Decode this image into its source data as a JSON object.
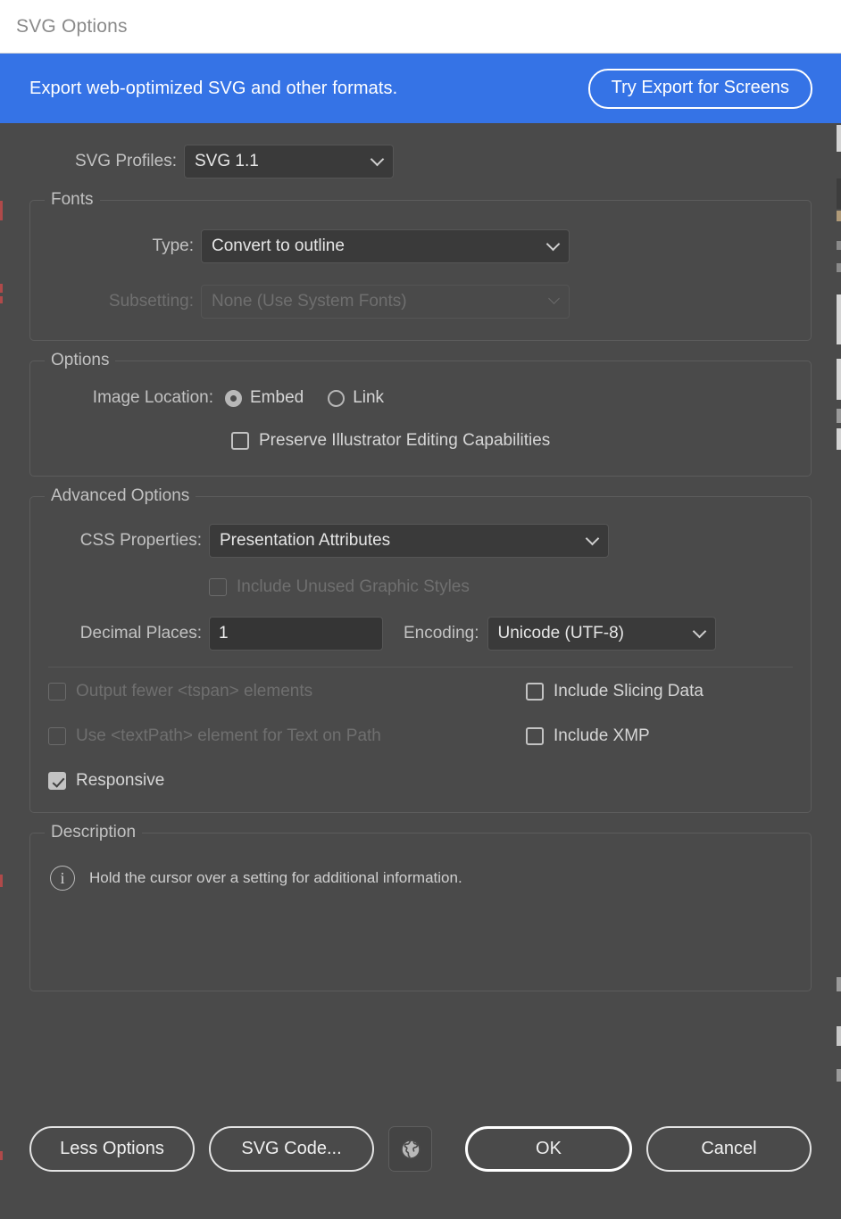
{
  "window": {
    "title": "SVG Options"
  },
  "promo": {
    "message": "Export web-optimized SVG and other formats.",
    "button_label": "Try Export for Screens",
    "background_color": "#3573e6"
  },
  "profiles": {
    "label": "SVG Profiles:",
    "value": "SVG 1.1"
  },
  "fonts": {
    "legend": "Fonts",
    "type": {
      "label": "Type:",
      "value": "Convert to outline"
    },
    "subsetting": {
      "label": "Subsetting:",
      "value": "None (Use System Fonts)",
      "enabled": false
    }
  },
  "options": {
    "legend": "Options",
    "image_location": {
      "label": "Image Location:",
      "choices": [
        {
          "label": "Embed",
          "selected": true
        },
        {
          "label": "Link",
          "selected": false
        }
      ]
    },
    "preserve": {
      "label": "Preserve Illustrator Editing Capabilities",
      "checked": false,
      "enabled": true
    }
  },
  "advanced": {
    "legend": "Advanced Options",
    "css_properties": {
      "label": "CSS Properties:",
      "value": "Presentation Attributes"
    },
    "include_unused_graphic_styles": {
      "label": "Include Unused Graphic Styles",
      "checked": false,
      "enabled": false
    },
    "decimal_places": {
      "label": "Decimal Places:",
      "value": "1"
    },
    "encoding": {
      "label": "Encoding:",
      "value": "Unicode (UTF-8)"
    },
    "checkboxes_left": [
      {
        "label": "Output fewer <tspan> elements",
        "checked": false,
        "enabled": false
      },
      {
        "label": "Use <textPath> element for Text on Path",
        "checked": false,
        "enabled": false
      },
      {
        "label": "Responsive",
        "checked": true,
        "enabled": true
      }
    ],
    "checkboxes_right": [
      {
        "label": "Include Slicing Data",
        "checked": false,
        "enabled": true
      },
      {
        "label": "Include XMP",
        "checked": false,
        "enabled": true
      }
    ]
  },
  "description": {
    "legend": "Description",
    "text": "Hold the cursor over a setting for additional information.",
    "icon": "info-icon"
  },
  "footer": {
    "less_options_label": "Less Options",
    "svg_code_label": "SVG Code...",
    "globe_icon": "globe-icon",
    "ok_label": "OK",
    "cancel_label": "Cancel"
  }
}
